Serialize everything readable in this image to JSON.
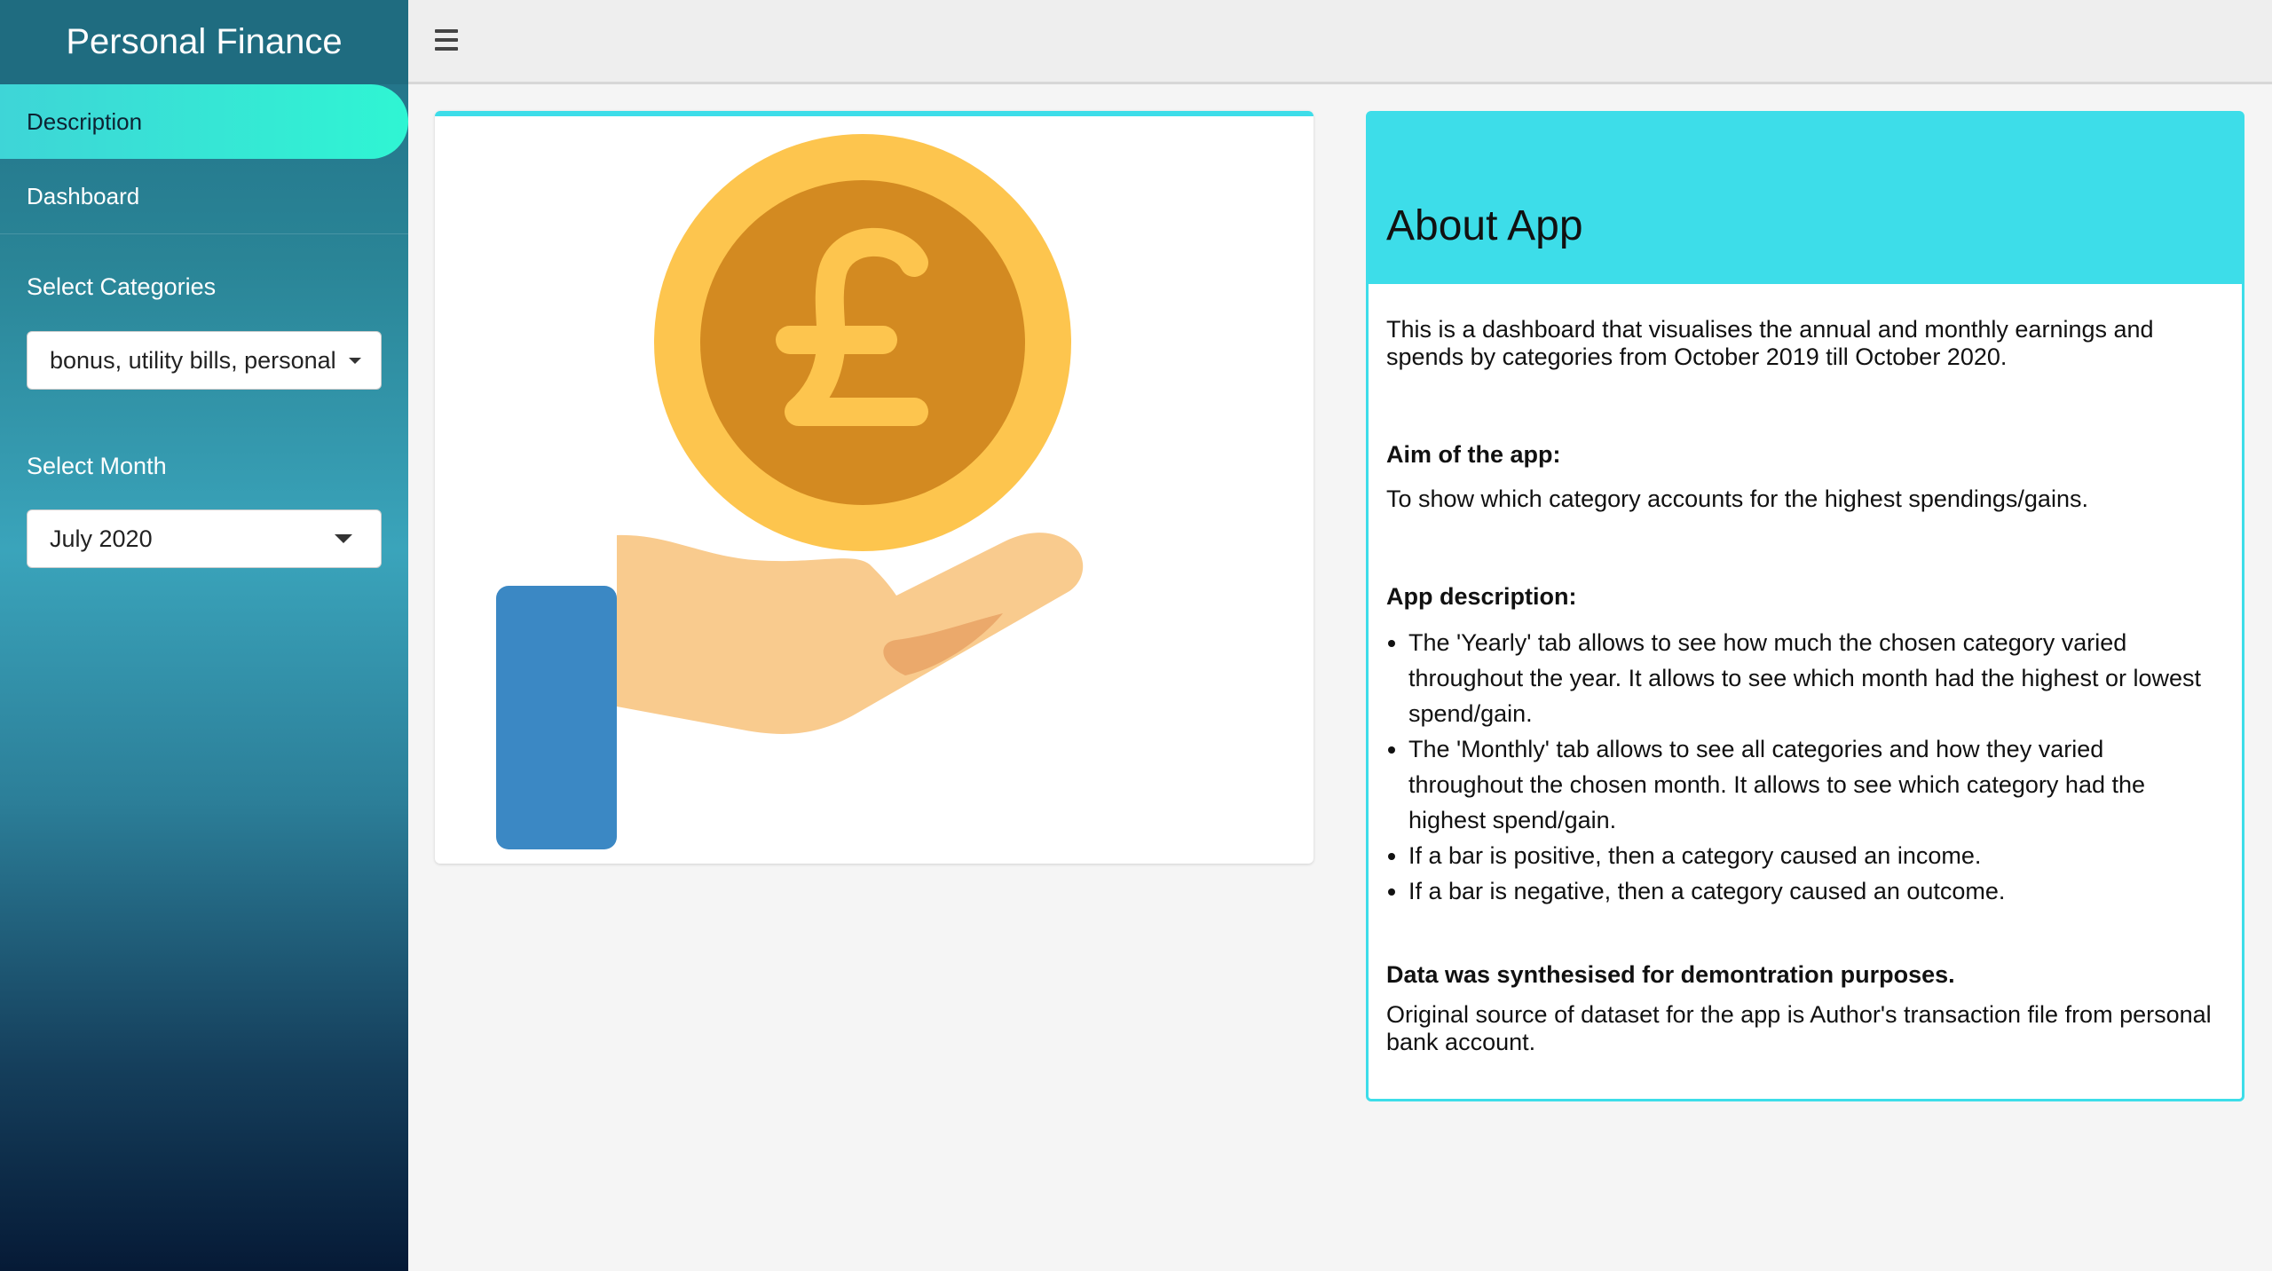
{
  "sidebar": {
    "title": "Personal Finance",
    "menu": [
      {
        "label": "Description",
        "active": true
      },
      {
        "label": "Dashboard",
        "active": false
      }
    ],
    "categories_label": "Select Categories",
    "categories_value": "bonus, utility bills, personal",
    "month_label": "Select Month",
    "month_value": "July 2020"
  },
  "header": {
    "menu_icon": "hamburger-icon"
  },
  "illustration": {
    "icon": "pound-coin-hand-icon"
  },
  "about": {
    "title": "About App",
    "intro": "This is a dashboard that visualises the annual and monthly earnings and spends by categories from October 2019 till October 2020.",
    "aim_heading": "Aim of the app:",
    "aim_text": "To show which category accounts for the highest spendings/gains.",
    "desc_heading": "App description:",
    "desc_items": [
      "The 'Yearly' tab allows to see how much the chosen category varied throughout the year. It allows to see which month had the highest or lowest spend/gain.",
      "The 'Monthly' tab allows to see all categories and how they varied throughout the chosen month. It allows to see which category had the highest spend/gain.",
      "If a bar is positive, then a category caused an income.",
      "If a bar is negative, then a category caused an outcome."
    ],
    "data_heading": "Data was synthesised for demontration purposes.",
    "data_text": "Original source of dataset for the app is Author's transaction file from personal bank account."
  },
  "colors": {
    "accent": "#3ddde9",
    "active_menu": "#2ff5d3",
    "coin_outer": "#fdc54e",
    "coin_inner": "#d38a21",
    "sleeve": "#3b88c4",
    "hand": "#f9cb8e"
  }
}
